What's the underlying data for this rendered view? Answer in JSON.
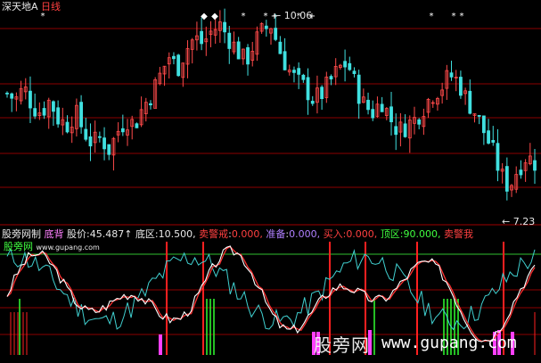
{
  "header": {
    "symbol": "深天地A",
    "period": "日线"
  },
  "price_panel": {
    "high_label": "10.06",
    "low_label": "7.23"
  },
  "indicator_panel": {
    "title": "股旁网制",
    "name": "底背",
    "fields": [
      {
        "label": "股价:",
        "value": "45.487↑",
        "color": "#e8e8e8"
      },
      {
        "label": "底区:",
        "value": "10.500,",
        "color": "#e8e8e8"
      },
      {
        "label": "卖警戒",
        "value": "0.000,",
        "color": "#ff4040"
      },
      {
        "label": "准备",
        "value": "0.000,",
        "color": "#b080ff"
      },
      {
        "label": "买入:",
        "value": "0.000,",
        "color": "#ff4040"
      },
      {
        "label": "顶区:",
        "value": "90.000,",
        "color": "#40ff40"
      },
      {
        "label": "卖警我",
        "value": "",
        "color": "#ff4040"
      }
    ],
    "brand_label": "股旁网",
    "brand_url": "www.gupang.com"
  },
  "watermark": {
    "text": "股旁网",
    "url": "www.gupang.com"
  },
  "colors": {
    "up": "#ff4a4a",
    "down": "#40e0e0",
    "grid": "#8b0000",
    "line_white": "#ffffff",
    "line_cyan": "#40d0d0",
    "line_red": "#ff3030",
    "bar_red": "#ff2020",
    "bar_green": "#30ff30",
    "bar_magenta": "#ff40ff",
    "top_line": "#30c030"
  },
  "chart_data": [
    {
      "type": "candlestick",
      "title": "深天地A 日线",
      "ylim": [
        7.0,
        10.2
      ],
      "marked_high": 10.06,
      "marked_low": 7.23,
      "closes": [
        8.9,
        8.8,
        9.0,
        8.7,
        8.6,
        8.8,
        8.5,
        8.4,
        8.6,
        8.3,
        8.1,
        8.2,
        8.0,
        8.3,
        8.5,
        8.4,
        8.7,
        8.9,
        9.2,
        9.5,
        9.3,
        9.6,
        9.8,
        9.7,
        9.9,
        10.0,
        9.8,
        9.6,
        9.4,
        9.7,
        9.9,
        10.0,
        9.6,
        9.3,
        9.1,
        9.0,
        8.8,
        8.9,
        9.1,
        9.3,
        9.4,
        9.0,
        8.7,
        8.6,
        8.8,
        8.5,
        8.3,
        8.4,
        8.5,
        8.7,
        8.9,
        9.0,
        9.2,
        9.1,
        8.8,
        8.6,
        8.3,
        8.0,
        7.6,
        7.4,
        7.7,
        7.9,
        7.8
      ]
    },
    {
      "type": "line",
      "title": "底背",
      "ylim": [
        0,
        100
      ],
      "series": [
        {
          "name": "底区",
          "values": [
            10.5
          ]
        },
        {
          "name": "顶区",
          "values": [
            90
          ]
        }
      ]
    }
  ]
}
